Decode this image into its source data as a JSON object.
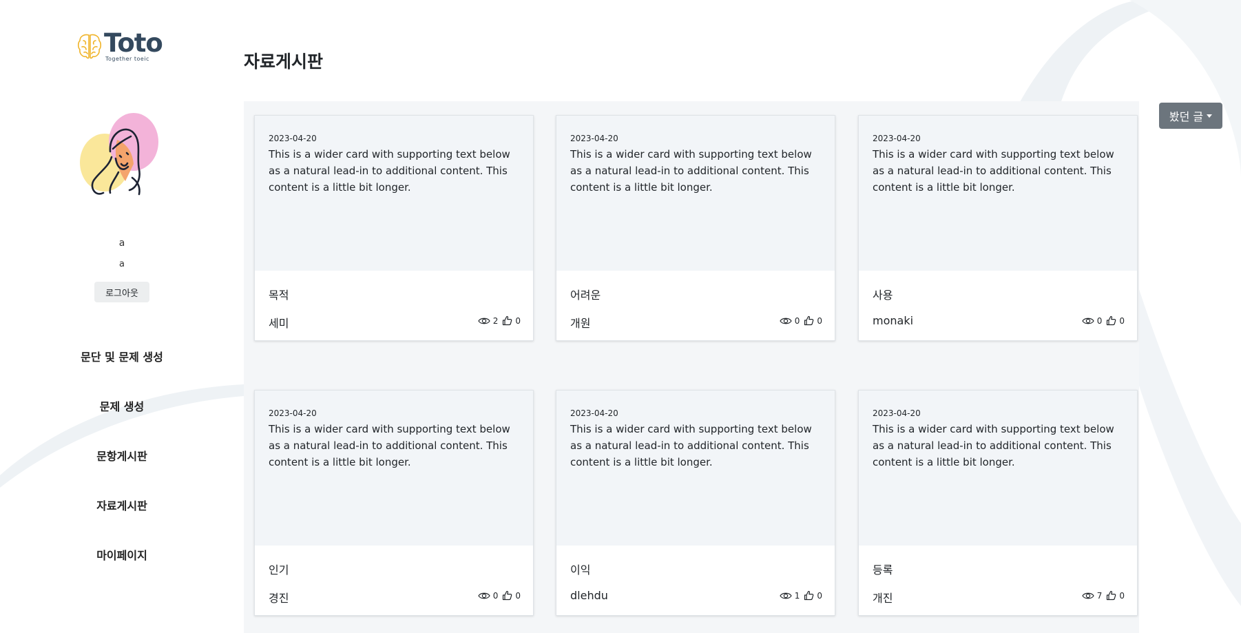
{
  "logo": {
    "title": "Toto",
    "subtitle": "Together toeic"
  },
  "user": {
    "name": "a",
    "id": "a",
    "logout_label": "로그아웃"
  },
  "nav": [
    {
      "label": "문단 및 문제 생성"
    },
    {
      "label": "문제 생성"
    },
    {
      "label": "문항게시판"
    },
    {
      "label": "자료게시판"
    },
    {
      "label": "마이페이지"
    }
  ],
  "page": {
    "title": "자료게시판"
  },
  "viewed_button": {
    "label": "봤던 글"
  },
  "cards": [
    {
      "date": "2023-04-20",
      "text": "This is a wider card with supporting text below as a natural lead-in to additional content. This content is a little bit longer.",
      "title": "목적",
      "author": "세미",
      "views": "2",
      "likes": "0"
    },
    {
      "date": "2023-04-20",
      "text": "This is a wider card with supporting text below as a natural lead-in to additional content. This content is a little bit longer.",
      "title": "어려운",
      "author": "개원",
      "views": "0",
      "likes": "0"
    },
    {
      "date": "2023-04-20",
      "text": "This is a wider card with supporting text below as a natural lead-in to additional content. This content is a little bit longer.",
      "title": "사용",
      "author": "monaki",
      "views": "0",
      "likes": "0"
    },
    {
      "date": "2023-04-20",
      "text": "This is a wider card with supporting text below as a natural lead-in to additional content. This content is a little bit longer.",
      "title": "인기",
      "author": "경진",
      "views": "0",
      "likes": "0"
    },
    {
      "date": "2023-04-20",
      "text": "This is a wider card with supporting text below as a natural lead-in to additional content. This content is a little bit longer.",
      "title": "이익",
      "author": "dlehdu",
      "views": "1",
      "likes": "0"
    },
    {
      "date": "2023-04-20",
      "text": "This is a wider card with supporting text below as a natural lead-in to additional content. This content is a little bit longer.",
      "title": "등록",
      "author": "개진",
      "views": "7",
      "likes": "0"
    }
  ],
  "icons": {
    "logo": "brain-icon",
    "views": "eye-icon",
    "likes": "thumbs-up-icon",
    "dropdown": "caret-down-icon"
  },
  "colors": {
    "accent": "#f0b429",
    "logo_text": "#34495e",
    "board_bg": "#f4f6f8",
    "button_secondary": "#6c757d"
  }
}
